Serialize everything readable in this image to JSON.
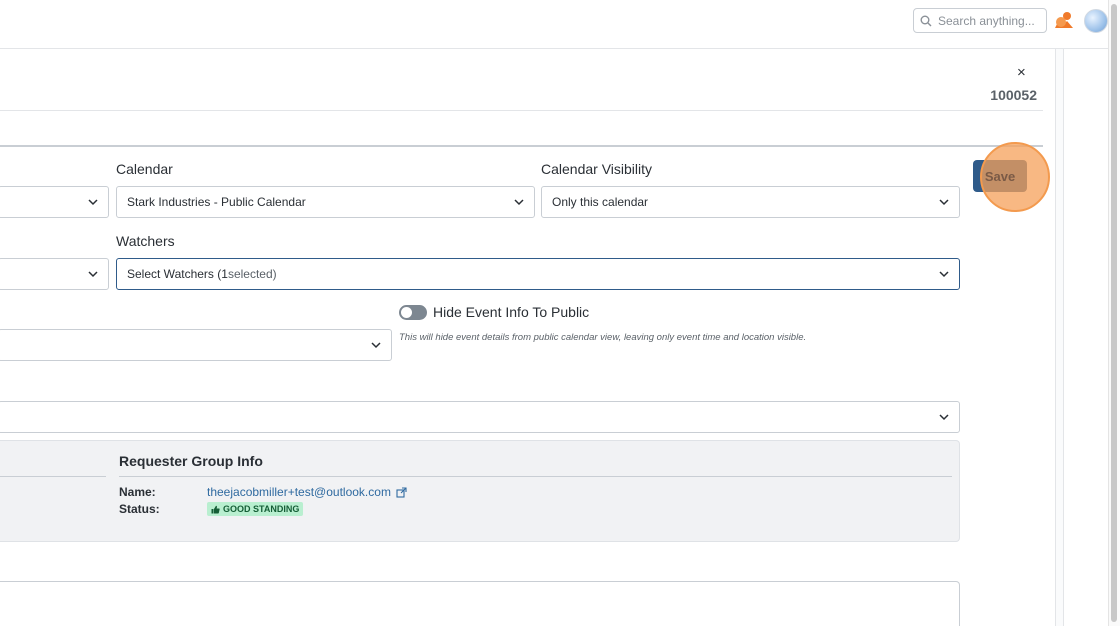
{
  "header": {
    "search_placeholder": "Search anything...",
    "notification_icon": "notification-bell-icon",
    "avatar": "user-avatar"
  },
  "record": {
    "close_label": "×",
    "id": "100052"
  },
  "form": {
    "calendar_label": "Calendar",
    "calendar_value": "Stark Industries - Public Calendar",
    "visibility_label": "Calendar Visibility",
    "visibility_value": "Only this calendar",
    "watchers_label": "Watchers",
    "watchers_value_prefix": "Select Watchers (",
    "watchers_count": "1",
    "watchers_value_suffix": " selected)",
    "hide_info_label": "Hide Event Info To Public",
    "hide_info_enabled": false,
    "hide_info_hint": "This will hide event details from public calendar view, leaving only event time and location visible.",
    "save_label": "Save"
  },
  "requester": {
    "title": "Requester Group Info",
    "name_key": "Name:",
    "name_value": "theejacobmiller+test@outlook.com",
    "status_key": "Status:",
    "status_value": "GOOD STANDING"
  },
  "colors": {
    "primary": "#2f5b8a",
    "highlight": "#f39a4e",
    "badge_bg": "#b9efd0",
    "link": "#2f6aa0"
  }
}
